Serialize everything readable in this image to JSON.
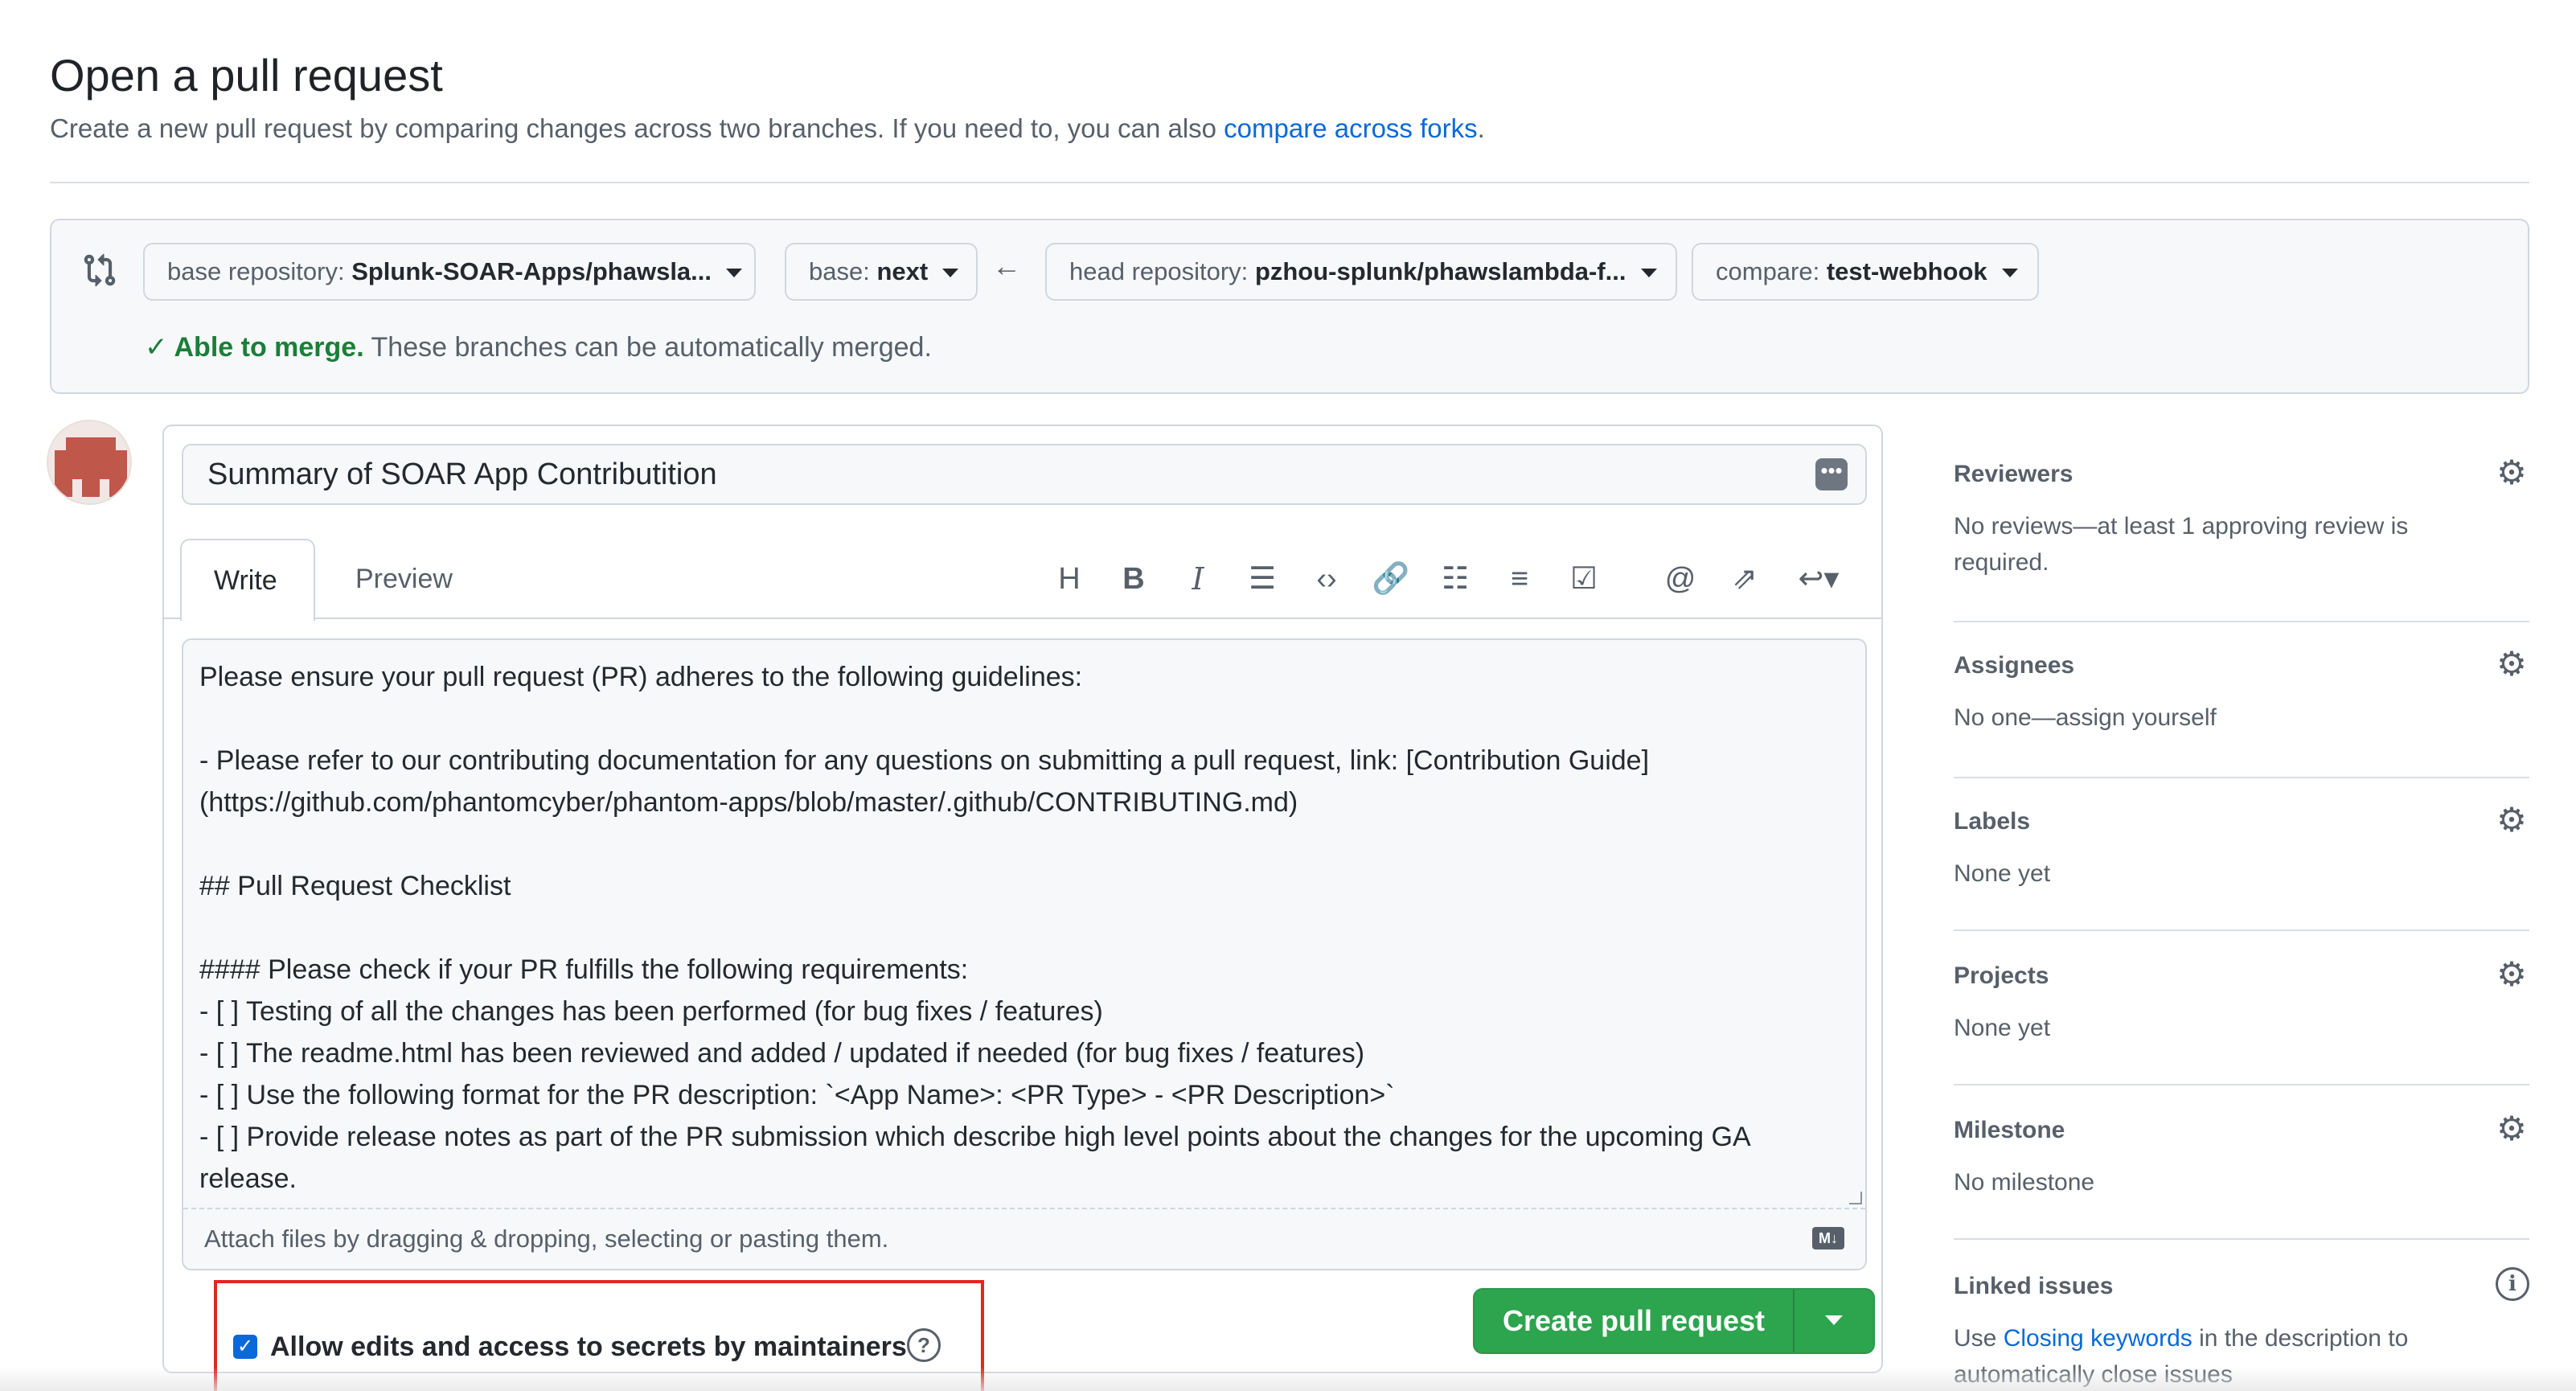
{
  "header": {
    "title": "Open a pull request",
    "subtitle": "Create a new pull request by comparing changes across two branches. If you need to, you can also ",
    "subtitle_link": "compare across forks",
    "subtitle_end": "."
  },
  "compare": {
    "base_repo_label": "base repository:",
    "base_repo_value": "Splunk-SOAR-Apps/phawsla...",
    "base_label": "base:",
    "base_value": "next",
    "head_repo_label": "head repository:",
    "head_repo_value": "pzhou-splunk/phawslambda-f...",
    "compare_label": "compare:",
    "compare_value": "test-webhook",
    "merge_ok": "Able to merge.",
    "merge_msg": "These branches can be automatically merged."
  },
  "form": {
    "title_value": "Summary of SOAR App Contributition",
    "tabs": [
      {
        "label": "Write",
        "active": true
      },
      {
        "label": "Preview",
        "active": false
      }
    ],
    "toolbar_icons": [
      "heading-icon",
      "bold-icon",
      "italic-icon",
      "quote-icon",
      "code-icon",
      "link-icon",
      "bulleted-list-icon",
      "numbered-list-icon",
      "task-list-icon",
      "mention-icon",
      "cross-reference-icon",
      "reply-icon"
    ],
    "body_text": "Please ensure your pull request (PR) adheres to the following guidelines:\n\n- Please refer to our contributing documentation for any questions on submitting a pull request, link: [Contribution Guide](https://github.com/phantomcyber/phantom-apps/blob/master/.github/CONTRIBUTING.md)\n\n## Pull Request Checklist\n\n#### Please check if your PR fulfills the following requirements:\n- [ ] Testing of all the changes has been performed (for bug fixes / features)\n- [ ] The readme.html has been reviewed and added / updated if needed (for bug fixes / features)\n- [ ] Use the following format for the PR description: `<App Name>: <PR Type> - <PR Description>`\n- [ ] Provide release notes as part of the PR submission which describe high level points about the changes for the upcoming GA release.",
    "attach_hint": "Attach files by dragging & dropping, selecting or pasting them.",
    "markdown_badge": "M↓",
    "allow_edits_label": "Allow edits and access to secrets by maintainers",
    "allow_edits_checked": true,
    "create_button": "Create pull request"
  },
  "sidebar": {
    "reviewers": {
      "title": "Reviewers",
      "text": "No reviews—at least 1 approving review is required."
    },
    "assignees": {
      "title": "Assignees",
      "text": "No one—assign yourself"
    },
    "labels": {
      "title": "Labels",
      "text": "None yet"
    },
    "projects": {
      "title": "Projects",
      "text": "None yet"
    },
    "milestone": {
      "title": "Milestone",
      "text": "No milestone"
    },
    "linked_issues": {
      "title": "Linked issues",
      "text_pre": "Use ",
      "link": "Closing keywords",
      "text_post": " in the description to automatically close issues"
    }
  },
  "colors": {
    "accent": "#0969da",
    "success": "#1a7f37",
    "button_green": "#2da44e",
    "highlight_red": "#e0281f"
  }
}
